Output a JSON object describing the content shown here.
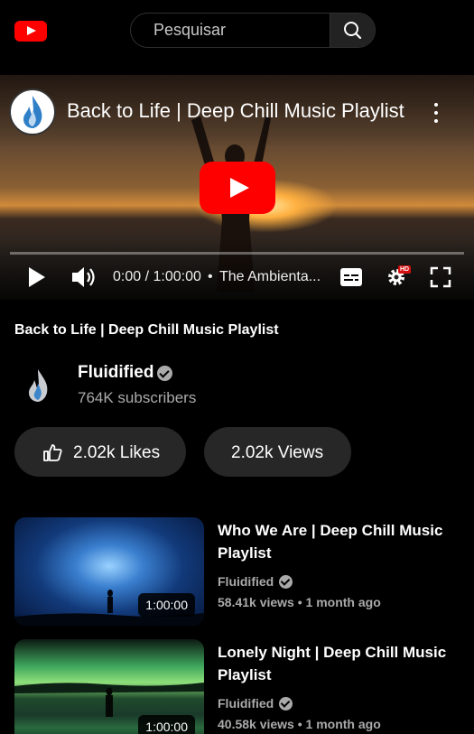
{
  "header": {
    "search_placeholder": "Pesquisar"
  },
  "player": {
    "title": "Back to Life | Deep Chill Music Playlist",
    "time": "0:00 / 1:00:00",
    "separator": "•",
    "chapter": "The Ambienta...",
    "progress": 0,
    "hd_badge": "HD"
  },
  "video": {
    "title": "Back to Life | Deep Chill Music Playlist",
    "channel_name": "Fluidified",
    "subscribers": "764K subscribers",
    "likes_label": "2.02k Likes",
    "views_label": "2.02k Views"
  },
  "related": [
    {
      "title": "Who We Are | Deep Chill Music Playlist",
      "channel": "Fluidified",
      "meta": "58.41k views • 1 month ago",
      "duration": "1:00:00"
    },
    {
      "title": "Lonely Night | Deep Chill Music Playlist",
      "channel": "Fluidified",
      "meta": "40.58k views • 1 month ago",
      "duration": "1:00:00"
    }
  ],
  "colors": {
    "accent": "#ff0000",
    "background": "#000000",
    "pill": "#272727",
    "secondary_text": "#aaaaaa"
  }
}
